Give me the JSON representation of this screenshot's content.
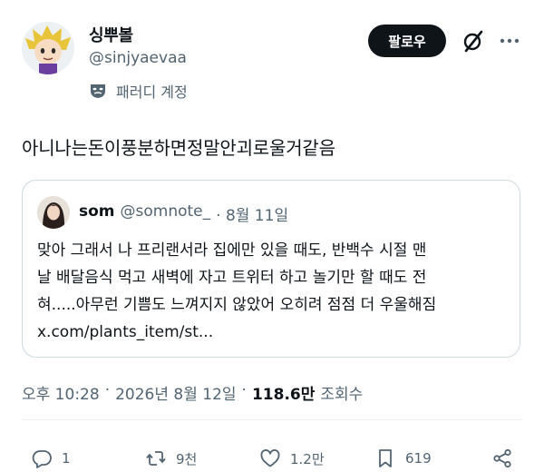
{
  "author": {
    "display_name": "싱뿌볼",
    "handle": "@sinjyaevaa",
    "label": "패러디 계정",
    "label_icon": "parody-mask-icon"
  },
  "header": {
    "follow_label": "팔로우",
    "grok_icon": "grok-slash-icon",
    "more_icon": "more-dots-icon"
  },
  "tweet": {
    "text": "아니나는돈이풍분하면정말안괴로울거같음"
  },
  "quote": {
    "name": "som",
    "handle": "@somnote_",
    "date": "· 8월 11일",
    "lines": [
      "맞아 그래서 나 프리랜서라 집에만 있을 때도, 반백수 시절 맨",
      "날 배달음식 먹고 새벽에 자고 트위터 하고 놀기만 할 때도 전",
      "혀.....아무런 기쁨도 느껴지지 않았어 오히려 점점 더 우울해짐",
      "x.com/plants_item/st..."
    ]
  },
  "meta": {
    "time": "오후 10:28",
    "sep1": "·",
    "date": "2026년 8월 12일",
    "sep2": "·",
    "views": "118.6만",
    "views_label": "조회수"
  },
  "actions": {
    "replies": "1",
    "reposts": "9천",
    "likes": "1.2만",
    "bookmarks": "619"
  },
  "colors": {
    "text": "#0f1419",
    "secondary": "#536471",
    "border": "#cfd9de",
    "button_bg": "#0f1419"
  }
}
